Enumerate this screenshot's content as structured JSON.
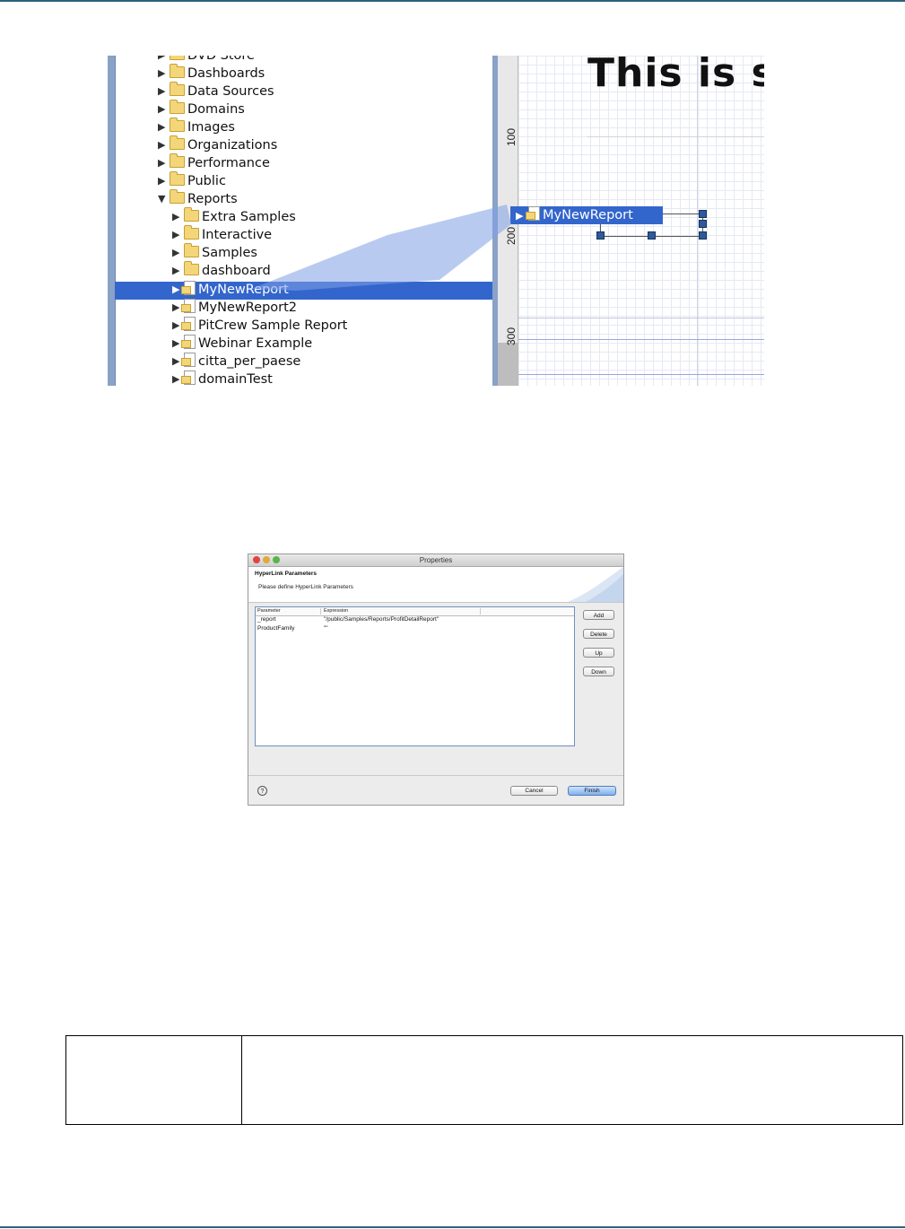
{
  "tree": {
    "items": [
      {
        "label": "DVD Store",
        "arrow": "▶",
        "icon": "folder-icon"
      },
      {
        "label": "Dashboards",
        "arrow": "▶",
        "icon": "folder-icon"
      },
      {
        "label": "Data Sources",
        "arrow": "▶",
        "icon": "folder-icon"
      },
      {
        "label": "Domains",
        "arrow": "▶",
        "icon": "folder-icon"
      },
      {
        "label": "Images",
        "arrow": "▶",
        "icon": "folder-icon"
      },
      {
        "label": "Organizations",
        "arrow": "▶",
        "icon": "folder-icon"
      },
      {
        "label": "Performance",
        "arrow": "▶",
        "icon": "folder-icon"
      },
      {
        "label": "Public",
        "arrow": "▶",
        "icon": "folder-icon"
      },
      {
        "label": "Reports",
        "arrow": "▼",
        "icon": "folder-icon"
      },
      {
        "label": "Extra Samples",
        "arrow": "▶",
        "icon": "folder-icon"
      },
      {
        "label": "Interactive",
        "arrow": "▶",
        "icon": "folder-icon"
      },
      {
        "label": "Samples",
        "arrow": "▶",
        "icon": "folder-icon"
      },
      {
        "label": "dashboard",
        "arrow": "▶",
        "icon": "folder-icon"
      },
      {
        "label": "MyNewReport",
        "arrow": "▶",
        "icon": "report-icon"
      },
      {
        "label": "MyNewReport2",
        "arrow": "▶",
        "icon": "report-icon"
      },
      {
        "label": "PitCrew Sample Report",
        "arrow": "▶",
        "icon": "report-icon"
      },
      {
        "label": "Webinar Example",
        "arrow": "▶",
        "icon": "report-icon"
      },
      {
        "label": "citta_per_paese",
        "arrow": "▶",
        "icon": "report-icon"
      },
      {
        "label": "domainTest",
        "arrow": "▶",
        "icon": "report-icon"
      }
    ]
  },
  "canvas": {
    "ruler_labels": [
      "100",
      "200",
      "300"
    ],
    "text": "This is s",
    "drag_label": "MyNewReport",
    "drag_arrow": "▶"
  },
  "dialog": {
    "title": "Properties",
    "header_title": "HyperLink Parameters",
    "header_subtitle": "Please define HyperLink Parameters",
    "columns": [
      "Parameter",
      "Expression"
    ],
    "rows": [
      {
        "parameter": "_report",
        "expression": "\"/public/Samples/Reports/ProfitDetailReport\""
      },
      {
        "parameter": "ProductFamily",
        "expression": "\"\""
      }
    ],
    "buttons": {
      "add": "Add",
      "delete": "Delete",
      "up": "Up",
      "down": "Down"
    },
    "help": "?",
    "cancel": "Cancel",
    "finish": "Finish"
  },
  "colors": {
    "selection": "#3366cc",
    "rule": "#2f5f7a",
    "folder": "#f4d67a"
  }
}
